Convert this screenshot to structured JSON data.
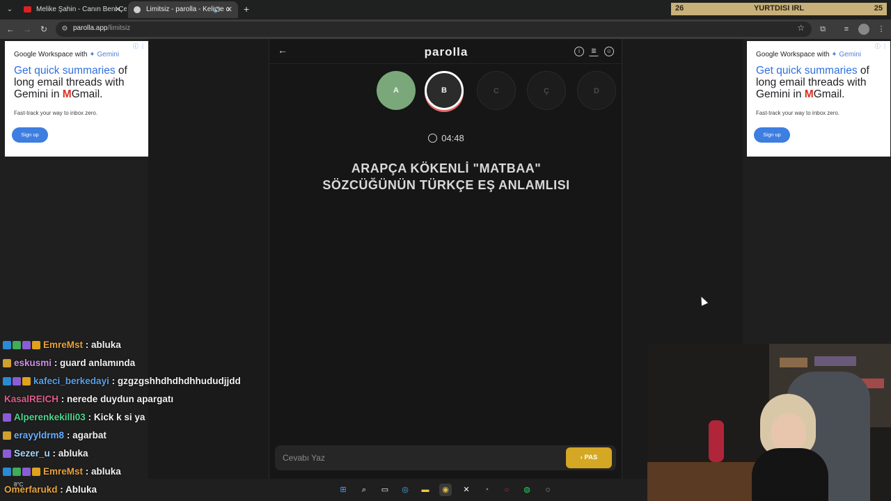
{
  "browser": {
    "tabs": [
      {
        "title": "Melike Şahin - Canın Beni Çekti",
        "active": false,
        "favicon_color": "#e02020"
      },
      {
        "title": "Limitsiz - parolla - Kelime o",
        "active": true,
        "favicon_color": "#cfcfcf"
      }
    ],
    "new_tab": "+",
    "url_host": "parolla.app",
    "url_path": "/limitsiz"
  },
  "overlay": {
    "left": "26",
    "center": "YURTDISI IRL",
    "right": "25"
  },
  "ads": {
    "brand": "Google Workspace with",
    "brand_gemini": "✦ Gemini",
    "headline_blue": "Get quick summaries",
    "headline_rest": " of long email threads with Gemini in",
    "headline_gmail": "Gmail.",
    "sub": "Fast-track your way to inbox zero.",
    "cta": "Sign up"
  },
  "app": {
    "logo": "parolla",
    "letters": [
      {
        "label": "A",
        "state": "done"
      },
      {
        "label": "B",
        "state": "current"
      },
      {
        "label": "C",
        "state": "todo"
      },
      {
        "label": "Ç",
        "state": "todo"
      },
      {
        "label": "D",
        "state": "todo"
      }
    ],
    "timer": "04:48",
    "question_line1": "ARAPÇA KÖKENLİ \"MATBAA\"",
    "question_line2": "SÖZCÜĞÜNÜN TÜRKÇE EŞ ANLAMLISI",
    "answer_placeholder": "Cevabı Yaz",
    "pass_label": "PAS"
  },
  "chat": [
    {
      "user": "EmreMst",
      "color": "#e8a33d",
      "text": ": abluka",
      "badges": [
        "#2b8ad6",
        "#3fae55",
        "#8a5cd6",
        "#e0a21b"
      ]
    },
    {
      "user": "eskusmi",
      "color": "#d18ee8",
      "text": ": guard anlamında",
      "badges": [
        "#d0a030"
      ]
    },
    {
      "user": "kafeci_berkedayi",
      "color": "#5aa0e8",
      "text": ": gzgzgshhdhdhdhhududjjdd",
      "badges": [
        "#2b8ad6",
        "#8a5cd6",
        "#e0a21b"
      ]
    },
    {
      "user": "KasalREICH",
      "color": "#e05c8a",
      "text": ": nerede duydun apargatı",
      "badges": []
    },
    {
      "user": "Alperenkekilli03",
      "color": "#4fd68a",
      "text": ": Kick k si ya",
      "badges": [
        "#8a5cd6"
      ]
    },
    {
      "user": "erayyldrm8",
      "color": "#6ab0ff",
      "text": ": agarbat",
      "badges": [
        "#d0a030"
      ]
    },
    {
      "user": "Sezer_u",
      "color": "#a8d8ff",
      "text": ": abluka",
      "badges": [
        "#8a5cd6"
      ]
    },
    {
      "user": "EmreMst",
      "color": "#e8a33d",
      "text": ": abluka",
      "badges": [
        "#2b8ad6",
        "#3fae55",
        "#8a5cd6",
        "#e0a21b"
      ]
    },
    {
      "user": "Omerfarukd",
      "color": "#e8a33d",
      "text": ": Abluka",
      "badges": []
    }
  ],
  "taskbar": {
    "weather": "8°C"
  }
}
